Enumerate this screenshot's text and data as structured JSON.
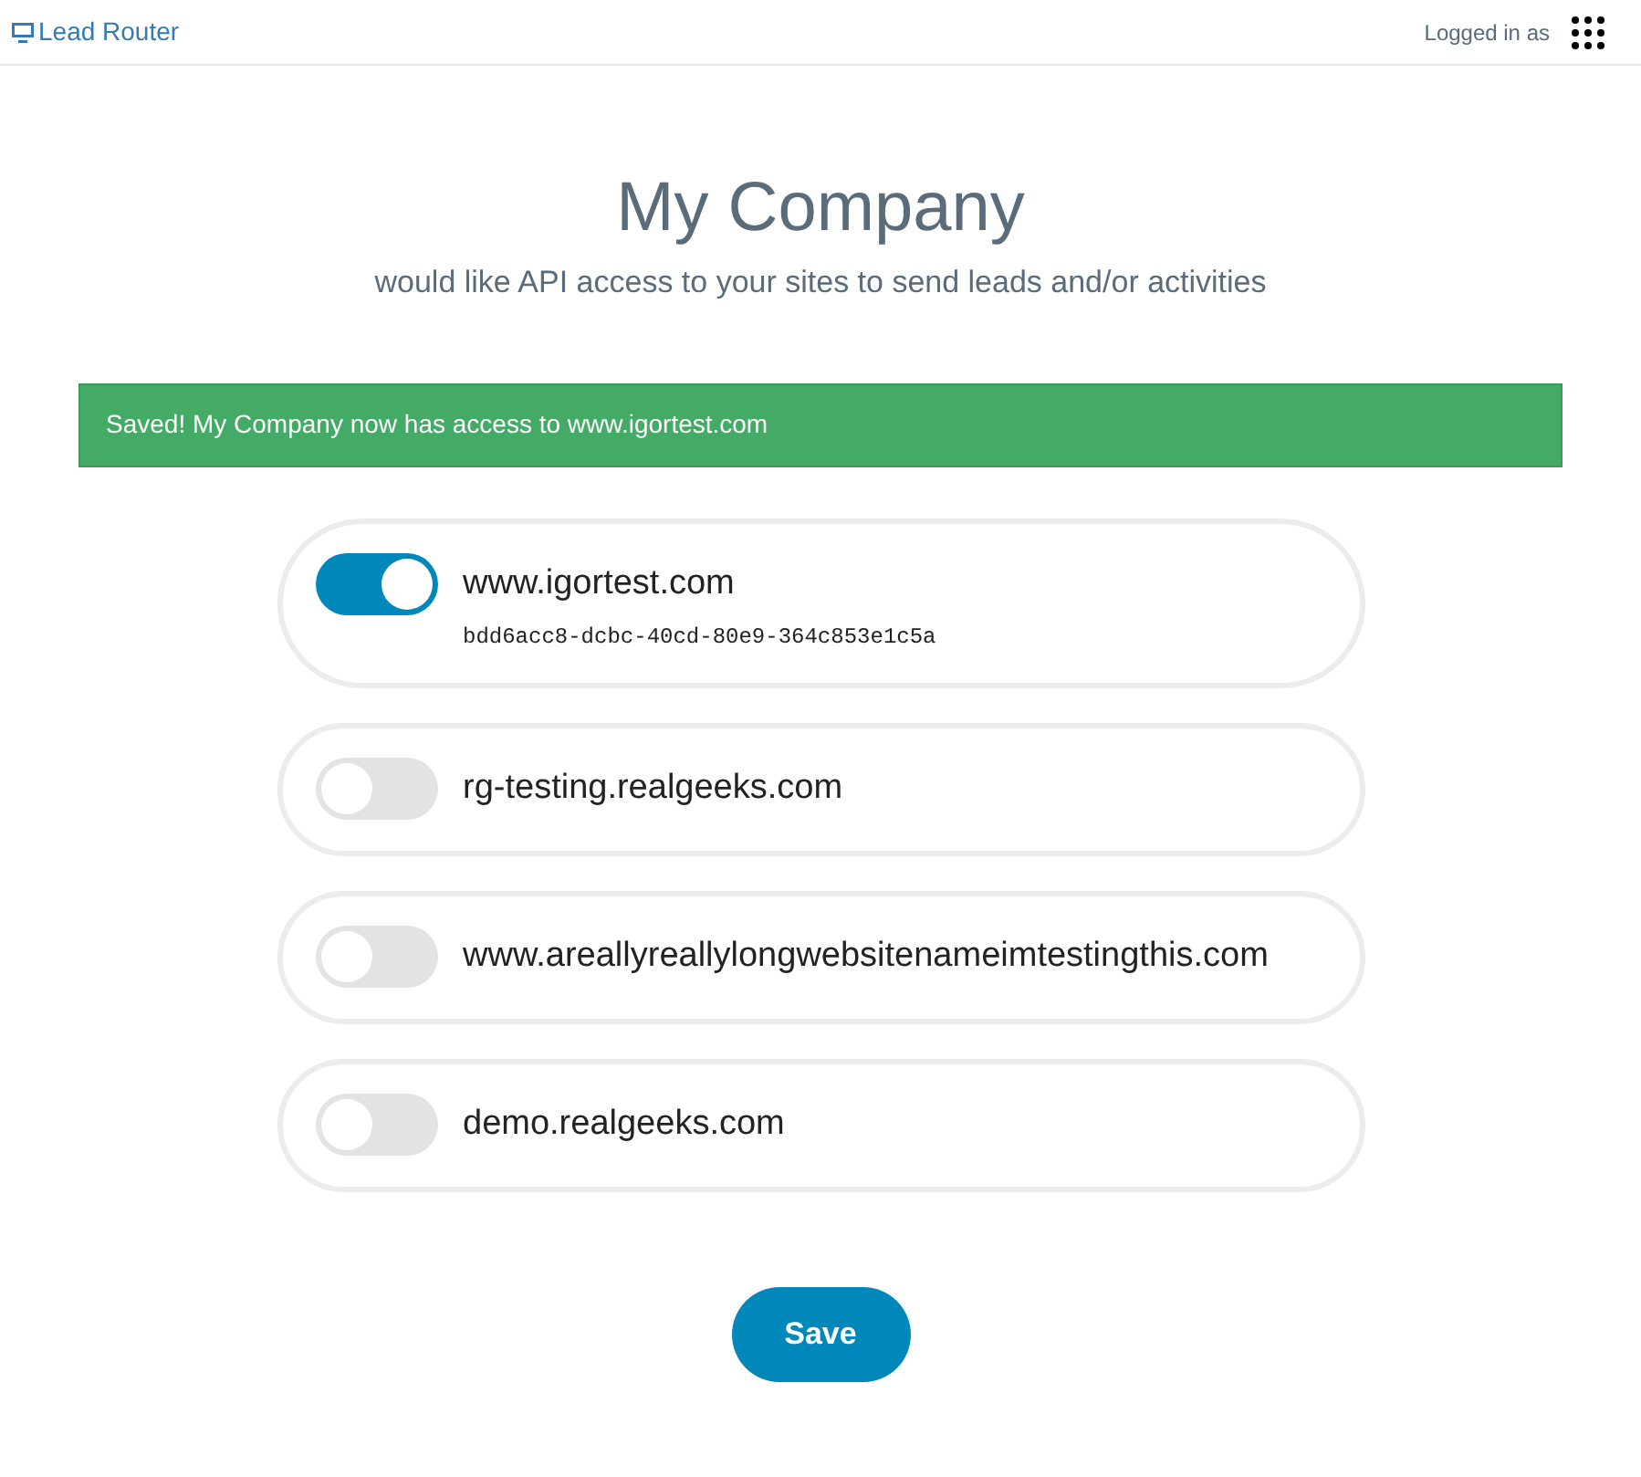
{
  "navbar": {
    "brand": "Lead Router",
    "user_label": "Logged in as"
  },
  "heading": {
    "title": "My Company",
    "subtitle": "would like API access to your sites to send leads and/or activities"
  },
  "alert": {
    "message": "Saved! My Company now has access to www.igortest.com"
  },
  "sites": [
    {
      "name": "www.igortest.com",
      "on": true,
      "key": "bdd6acc8-dcbc-40cd-80e9-364c853e1c5a"
    },
    {
      "name": "rg-testing.realgeeks.com",
      "on": false
    },
    {
      "name": "www.areallyreallylongwebsitenameimtestingthis.com",
      "on": false
    },
    {
      "name": "demo.realgeeks.com",
      "on": false
    }
  ],
  "save_button": "Save"
}
